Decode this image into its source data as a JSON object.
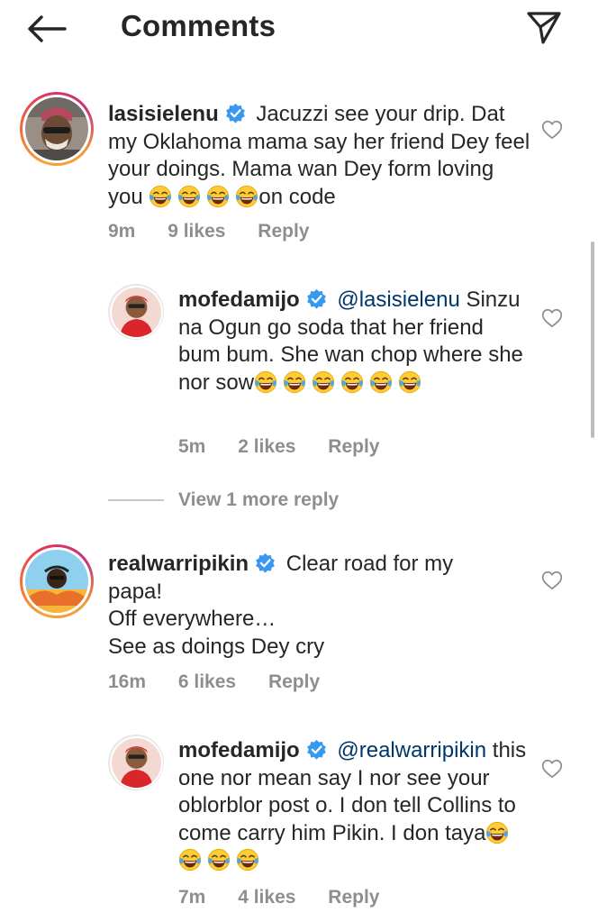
{
  "header": {
    "title": "Comments"
  },
  "comments": [
    {
      "username": "lasisielenu",
      "text": "Jacuzzi see your drip. Dat my Oklahoma mama say her friend Dey feel your doings. Mama wan Dey form loving you",
      "text_tail": "on code",
      "time": "9m",
      "likes": "9 likes",
      "reply": "Reply"
    },
    {
      "username": "mofedamijo",
      "mention": "@lasisielenu",
      "text": "Sinzu na Ogun go soda that her friend bum bum. She wan chop where she nor sow",
      "time": "5m",
      "likes": "2 likes",
      "reply": "Reply"
    },
    {
      "username": "realwarripikin",
      "line1": "Clear road for my",
      "line2": "papa!",
      "line3": "Off everywhere…",
      "line4": "See as doings Dey cry",
      "time": "16m",
      "likes": "6 likes",
      "reply": "Reply"
    },
    {
      "username": "mofedamijo",
      "mention": "@realwarripikin",
      "text": "this one nor mean say I nor see your oblorblor post o. I don tell Collins to come carry him Pikin. I don taya",
      "time": "7m",
      "likes": "4 likes",
      "reply": "Reply"
    }
  ],
  "view_more": "View 1 more reply",
  "icons": {
    "back": "arrow-left-icon",
    "send": "paper-plane-icon",
    "verified": "verified-badge-icon",
    "heart": "heart-outline-icon",
    "emoji": "face-with-tears-of-joy-emoji"
  },
  "colors": {
    "text": "#262626",
    "meta": "#8e8e8e",
    "mention": "#00376b",
    "verified": "#3897f0"
  }
}
